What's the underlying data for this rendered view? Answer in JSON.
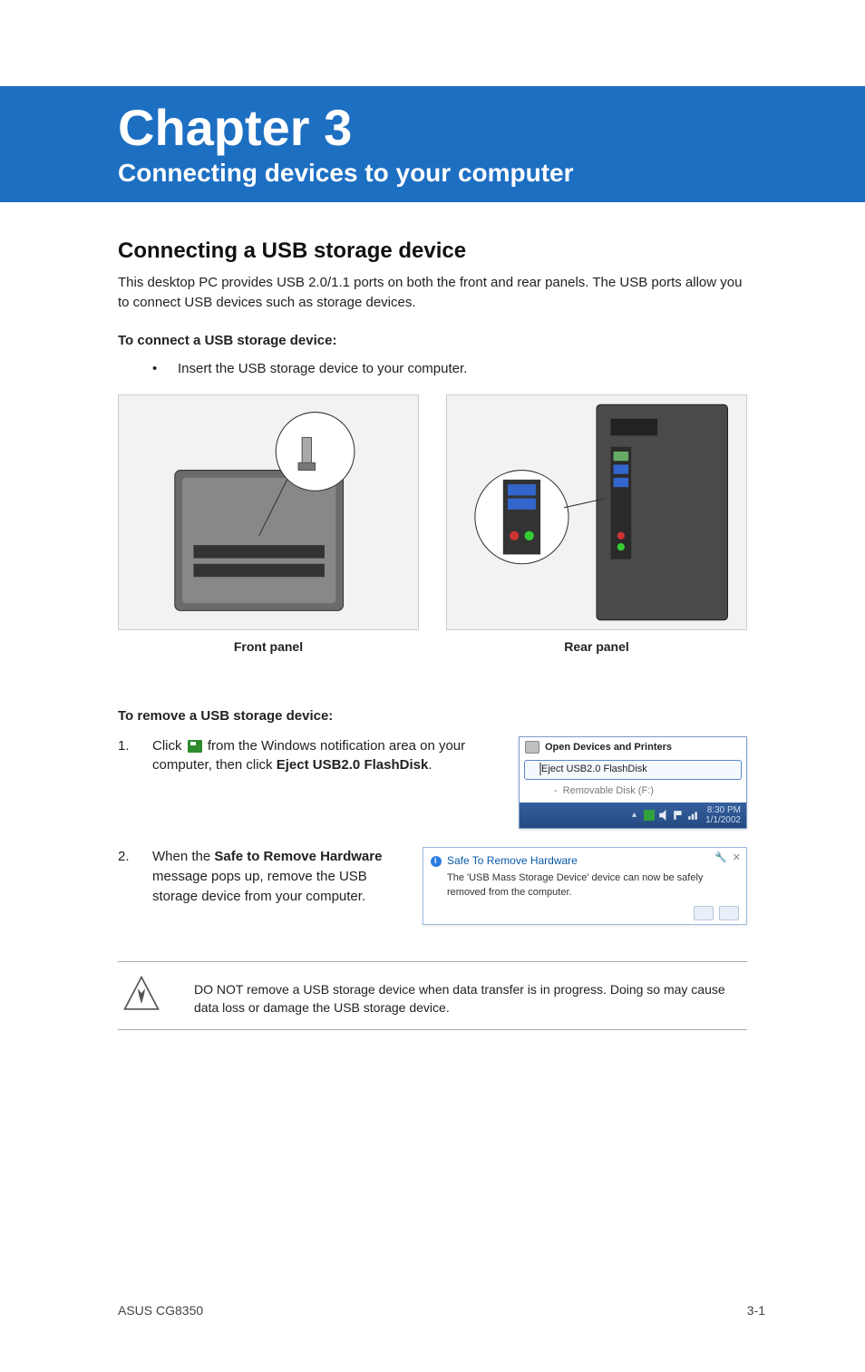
{
  "banner": {
    "chapter_title": "Chapter 3",
    "chapter_subtitle": "Connecting devices to your computer"
  },
  "section": {
    "heading": "Connecting a USB storage device",
    "intro": "This desktop PC provides USB 2.0/1.1 ports on both the front and rear panels. The USB ports allow you to connect USB devices such as storage devices.",
    "connect_heading": "To connect a USB storage device:",
    "connect_bullet": "Insert the USB storage device to your computer.",
    "front_label": "Front panel",
    "rear_label": "Rear panel",
    "remove_heading": "To remove a USB storage device:",
    "step1_pre": "Click ",
    "step1_post": " from the Windows notification area on your computer, then click ",
    "step1_bold": "Eject USB2.0 FlashDisk",
    "step1_end": ".",
    "step2_pre": "When the ",
    "step2_bold": "Safe to Remove Hardware",
    "step2_post": " message pops up, remove the USB storage device from your computer."
  },
  "popup": {
    "header": "Open Devices and Printers",
    "eject": "Eject USB2.0 FlashDisk",
    "sub": "Removable Disk (F:)",
    "time": "8:30 PM",
    "date": "1/1/2002"
  },
  "notify": {
    "title": "Safe To Remove Hardware",
    "body": "The 'USB Mass Storage Device' device can now be safely removed from the computer."
  },
  "warning": "DO NOT remove a USB storage device when data transfer is in progress. Doing so may cause data loss or damage the USB storage device.",
  "footer": {
    "model": "ASUS CG8350",
    "page": "3-1"
  }
}
